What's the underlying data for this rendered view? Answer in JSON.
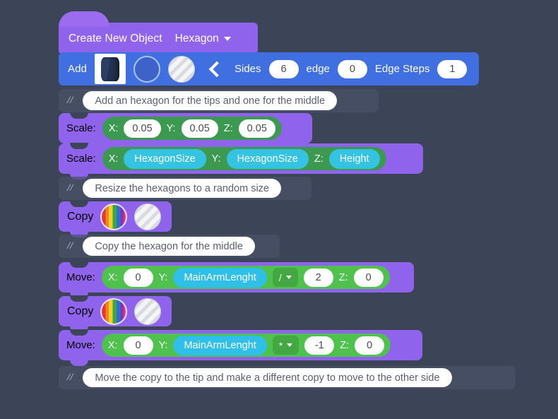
{
  "canvas": {
    "background": "#3c4458"
  },
  "header_block": {
    "title": "Create New Object",
    "object_type": "Hexagon",
    "dropdown_icon": "chevron-down-icon",
    "color": "#9063ec"
  },
  "add_block": {
    "label": "Add",
    "color": "#3f6fe0",
    "thumbnail_icon": "hexagon-prism-thumbnail",
    "material_icon": "blue-circle-swatch",
    "texture_icon": "silver-striped-circle-swatch",
    "collapse_icon": "chevron-left-icon",
    "fields": [
      {
        "label": "Sides",
        "value": "6"
      },
      {
        "label": "edge",
        "value": "0"
      },
      {
        "label": "Edge Steps",
        "value": "1"
      }
    ]
  },
  "comments": [
    {
      "marker": "//",
      "text": "Add an hexagon for the tips and one for the middle"
    },
    {
      "marker": "//",
      "text": "Resize the hexagons to a random size"
    },
    {
      "marker": "//",
      "text": "Copy the hexagon for the middle"
    },
    {
      "marker": "//",
      "text": "Move the copy to the tip and make a different copy to move to the other side"
    }
  ],
  "scale_block_1": {
    "label": "Scale:",
    "inner_color": "#3c9a50",
    "axes": [
      {
        "axis": "X:",
        "value": "0.05",
        "kind": "number"
      },
      {
        "axis": "Y:",
        "value": "0.05",
        "kind": "number"
      },
      {
        "axis": "Z:",
        "value": "0.05",
        "kind": "number"
      }
    ]
  },
  "scale_block_2": {
    "label": "Scale:",
    "inner_color": "#3c9a50",
    "axes": [
      {
        "axis": "X:",
        "value": "HexagonSize",
        "kind": "variable"
      },
      {
        "axis": "Y:",
        "value": "HexagonSize",
        "kind": "variable"
      },
      {
        "axis": "Z:",
        "value": "Height",
        "kind": "variable"
      }
    ]
  },
  "copy_block_1": {
    "label": "Copy",
    "color_icon": "rainbow-circle-swatch",
    "texture_icon": "silver-striped-circle-swatch"
  },
  "copy_block_2": {
    "label": "Copy",
    "color_icon": "rainbow-circle-swatch",
    "texture_icon": "silver-striped-circle-swatch"
  },
  "move_block_1": {
    "label": "Move:",
    "inner_color": "#4ec24c",
    "x": {
      "axis": "X:",
      "value": "0"
    },
    "y": {
      "axis": "Y:",
      "variable": "MainArmLenght",
      "operator": "/",
      "operand": "2"
    },
    "z": {
      "axis": "Z:",
      "value": "0"
    }
  },
  "move_block_2": {
    "label": "Move:",
    "inner_color": "#4ec24c",
    "x": {
      "axis": "X:",
      "value": "0"
    },
    "y": {
      "axis": "Y:",
      "variable": "MainArmLenght",
      "operator": "*",
      "operand": "-1"
    },
    "z": {
      "axis": "Z:",
      "value": "0"
    }
  }
}
